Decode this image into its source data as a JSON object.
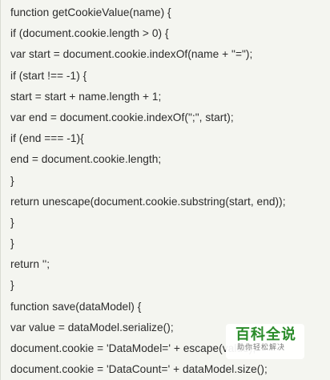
{
  "code": {
    "lines": [
      "function getCookieValue(name) {",
      "if (document.cookie.length > 0) {",
      "var start = document.cookie.indexOf(name + \"=\");",
      "if (start !== -1) {",
      "start = start + name.length + 1;",
      "var end = document.cookie.indexOf(\";\", start);",
      "if (end === -1){",
      "end = document.cookie.length;",
      "}",
      "return unescape(document.cookie.substring(start, end));",
      "}",
      "}",
      "return '';",
      "}",
      "function save(dataModel) {",
      "var value = dataModel.serialize();",
      "document.cookie = 'DataModel=' + escape(value);",
      "document.cookie = 'DataCount=' + dataModel.size();"
    ]
  },
  "watermark": {
    "main": "百科全说",
    "sub": "助你轻松解决"
  }
}
